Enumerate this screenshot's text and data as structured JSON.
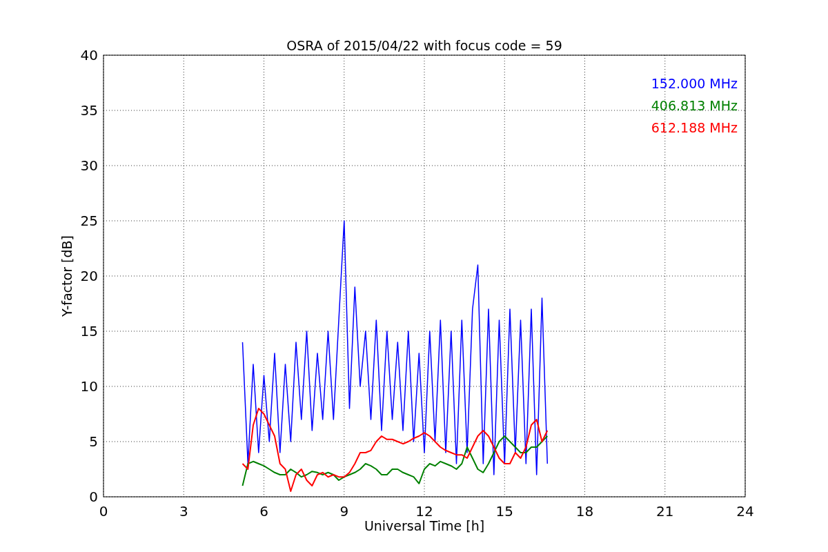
{
  "chart_data": {
    "type": "line",
    "title": "OSRA of 2015/04/22 with focus code = 59",
    "xlabel": "Universal Time [h]",
    "ylabel": "Y-factor [dB]",
    "x": [
      5.2,
      5.4,
      5.6,
      5.8,
      6.0,
      6.2,
      6.4,
      6.6,
      6.8,
      7.0,
      7.2,
      7.4,
      7.6,
      7.8,
      8.0,
      8.2,
      8.4,
      8.6,
      8.8,
      9.0,
      9.2,
      9.4,
      9.6,
      9.8,
      10.0,
      10.2,
      10.4,
      10.6,
      10.8,
      11.0,
      11.2,
      11.4,
      11.6,
      11.8,
      12.0,
      12.2,
      12.4,
      12.6,
      12.8,
      13.0,
      13.2,
      13.4,
      13.6,
      13.8,
      14.0,
      14.2,
      14.4,
      14.6,
      14.8,
      15.0,
      15.2,
      15.4,
      15.6,
      15.8,
      16.0,
      16.2,
      16.4,
      16.6
    ],
    "series": [
      {
        "name": "152.000 MHz",
        "color": "#0000ff",
        "values": [
          14,
          3,
          12,
          4,
          11,
          5,
          13,
          4,
          12,
          5,
          14,
          7,
          15,
          6,
          13,
          7,
          15,
          7,
          16,
          25,
          8,
          19,
          10,
          15,
          7,
          16,
          6,
          15,
          7,
          14,
          6,
          15,
          5,
          13,
          4,
          15,
          5,
          16,
          4,
          15,
          3,
          16,
          4,
          17,
          21,
          3,
          17,
          2,
          16,
          3,
          17,
          4,
          16,
          3,
          17,
          2,
          18,
          3
        ]
      },
      {
        "name": "406.813 MHz",
        "color": "#008000",
        "values": [
          1,
          3,
          3.2,
          3,
          2.8,
          2.5,
          2.2,
          2,
          2,
          2.5,
          2.2,
          1.8,
          2,
          2.3,
          2.2,
          2,
          2.2,
          2,
          1.5,
          1.8,
          2,
          2.2,
          2.5,
          3,
          2.8,
          2.5,
          2,
          2,
          2.5,
          2.5,
          2.2,
          2,
          1.8,
          1.2,
          2.5,
          3,
          2.8,
          3.2,
          3,
          2.8,
          2.5,
          3,
          4.5,
          3.5,
          2.5,
          2.2,
          3,
          4,
          5,
          5.5,
          5,
          4.5,
          4,
          4,
          4.5,
          4.5,
          5,
          5.5
        ]
      },
      {
        "name": "612.188 MHz",
        "color": "#ff0000",
        "values": [
          3,
          2.5,
          6.5,
          8,
          7.5,
          6.5,
          5.5,
          3,
          2.5,
          0.5,
          2,
          2.5,
          1.5,
          1,
          2,
          2.2,
          1.8,
          2,
          1.8,
          1.8,
          2.2,
          3,
          4,
          4,
          4.2,
          5,
          5.5,
          5.2,
          5.2,
          5,
          4.8,
          5,
          5.3,
          5.5,
          5.8,
          5.5,
          5,
          4.5,
          4.2,
          4,
          3.8,
          3.8,
          3.5,
          4.5,
          5.5,
          6,
          5.5,
          4.5,
          3.5,
          3,
          3,
          4,
          3.5,
          4.5,
          6.5,
          7,
          5,
          6
        ]
      }
    ],
    "xlim": [
      0,
      24
    ],
    "ylim": [
      0,
      40
    ],
    "xticks": [
      0,
      3,
      6,
      9,
      12,
      15,
      18,
      21,
      24
    ],
    "yticks": [
      0,
      5,
      10,
      15,
      20,
      25,
      30,
      35,
      40
    ],
    "grid": true
  }
}
